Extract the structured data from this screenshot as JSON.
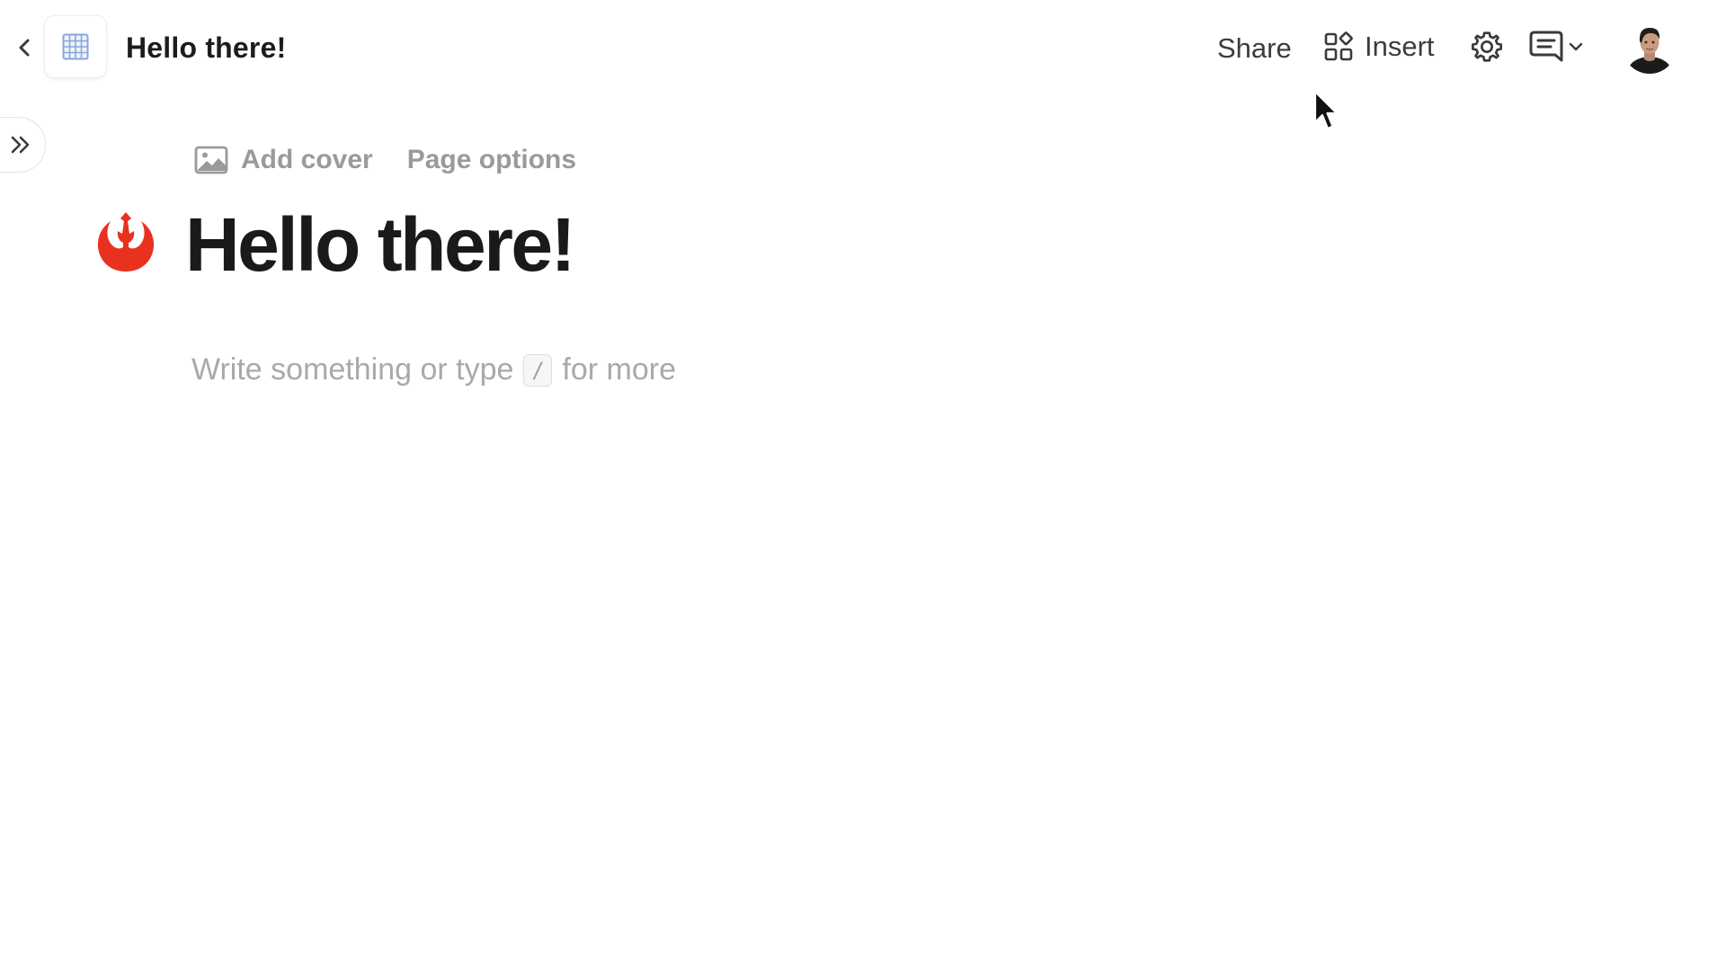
{
  "topbar": {
    "back_icon": "chevron-left-icon",
    "doc_icon": "grid-table-icon",
    "title": "Hello there!",
    "share_label": "Share",
    "insert_label": "Insert",
    "insert_icon": "grid-shapes-icon",
    "settings_icon": "gear-icon",
    "comments_icon": "comment-icon",
    "avatar": "user-avatar"
  },
  "sidebar": {
    "toggle_icon": "double-chevron-right-icon"
  },
  "page": {
    "add_cover_label": "Add cover",
    "add_cover_icon": "image-icon",
    "page_options_label": "Page options",
    "emoji": "rebel-alliance-icon",
    "heading": "Hello there!",
    "placeholder_before": "Write something or type",
    "placeholder_key": "/",
    "placeholder_after": "for more"
  },
  "colors": {
    "accent_red": "#e8321f",
    "grid_icon_blue": "#8aa6dd",
    "muted_text": "#9a9a9a"
  }
}
